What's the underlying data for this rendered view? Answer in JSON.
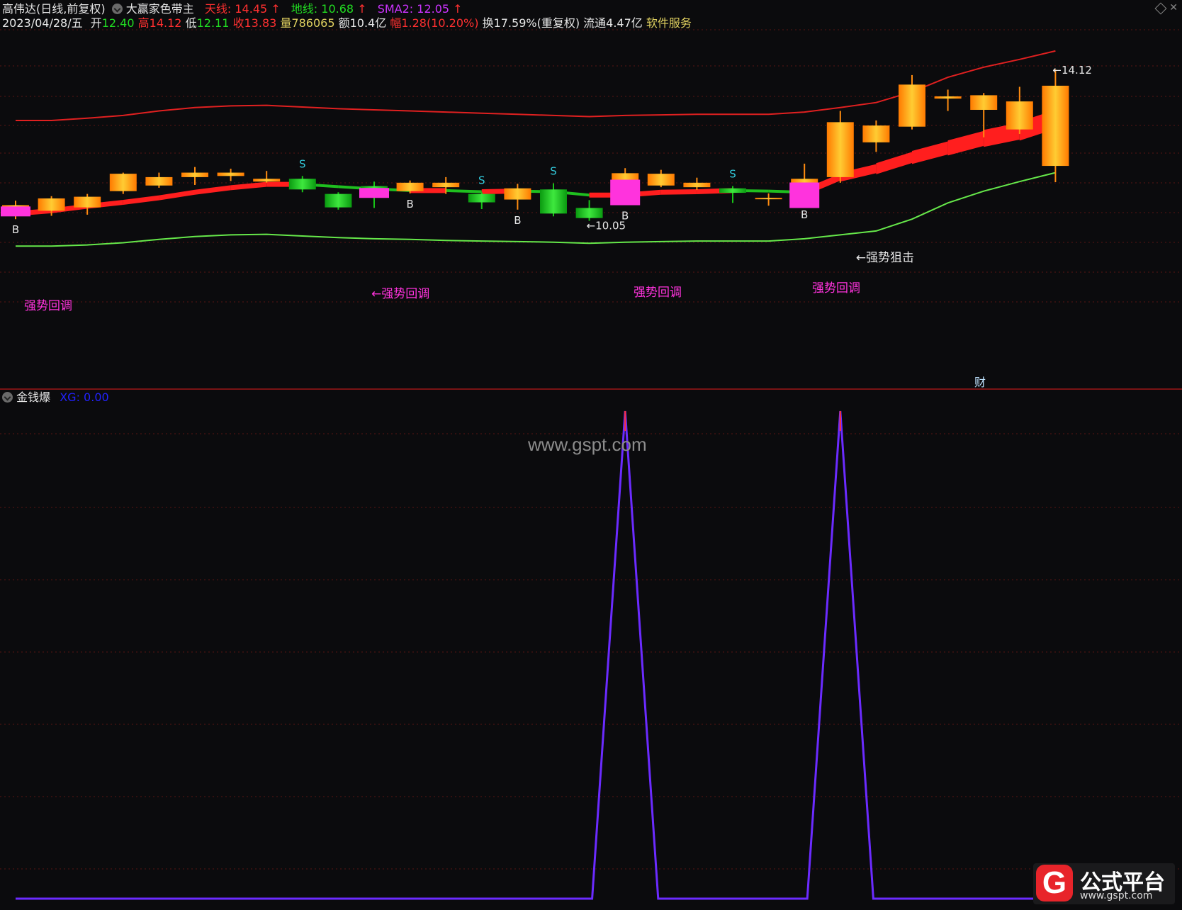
{
  "header": {
    "stock": "高伟达(日线,前复权)",
    "indicator_name": "大赢家色带主",
    "tianxian_label": "天线:",
    "tianxian_value": "14.45",
    "dixian_label": "地线:",
    "dixian_value": "10.68",
    "sma2_label": "SMA2:",
    "sma2_value": "12.05",
    "arrow": "↑",
    "date": "2023/04/28/五",
    "open_label": "开",
    "open_value": "12.40",
    "high_label": "高",
    "high_value": "14.12",
    "low_label": "低",
    "low_value": "12.11",
    "close_label": "收",
    "close_value": "13.83",
    "volume_label": "量",
    "volume_value": "786065",
    "amount": "额10.4亿",
    "range_label": "幅",
    "range_value": "1.28(10.20%)",
    "turnover": "换17.59%(重复权)",
    "float_cap": "流通4.47亿",
    "service": "软件服务"
  },
  "indicator": {
    "name": "金钱爆",
    "xg_label": "XG:",
    "xg_value": "0.00"
  },
  "colors": {
    "bg": "#0b0b0d",
    "up": "#ff9a1a",
    "down": "#14c21a",
    "upper_band": "#e02020",
    "lower_band": "#66e84a",
    "signal": "#ff33dd",
    "xg_line": "#6b2bff",
    "grid": "#5a1414",
    "text_white": "#e6e6e6",
    "text_red": "#ff3030",
    "text_green": "#22dd22",
    "text_magenta": "#cc33ff",
    "text_yellow": "#e0d060",
    "text_cyan": "#33ccdd",
    "text_blue": "#2222ff"
  },
  "chart_data": [
    {
      "type": "candlestick",
      "title": "大赢家色带主",
      "candles": [
        {
          "o": 11.55,
          "c": 11.7,
          "h": 11.78,
          "l": 11.45
        },
        {
          "o": 11.6,
          "c": 11.82,
          "h": 11.86,
          "l": 11.51
        },
        {
          "o": 11.66,
          "c": 11.85,
          "h": 11.9,
          "l": 11.53
        },
        {
          "o": 11.95,
          "c": 12.26,
          "h": 12.28,
          "l": 11.9
        },
        {
          "o": 12.05,
          "c": 12.2,
          "h": 12.28,
          "l": 12.01
        },
        {
          "o": 12.2,
          "c": 12.28,
          "h": 12.38,
          "l": 12.06
        },
        {
          "o": 12.22,
          "c": 12.28,
          "h": 12.35,
          "l": 12.13
        },
        {
          "o": 12.12,
          "c": 12.17,
          "h": 12.31,
          "l": 12.1
        },
        {
          "o": 12.17,
          "c": 11.98,
          "h": 12.22,
          "l": 11.93
        },
        {
          "o": 11.9,
          "c": 11.66,
          "h": 11.93,
          "l": 11.62
        },
        {
          "o": 12.04,
          "c": 11.88,
          "h": 12.12,
          "l": 11.65
        },
        {
          "o": 11.95,
          "c": 12.1,
          "h": 12.14,
          "l": 11.91
        },
        {
          "o": 12.02,
          "c": 12.1,
          "h": 12.2,
          "l": 11.9
        },
        {
          "o": 11.9,
          "c": 11.75,
          "h": 11.93,
          "l": 11.63
        },
        {
          "o": 11.8,
          "c": 12.0,
          "h": 12.08,
          "l": 11.62
        },
        {
          "o": 11.98,
          "c": 11.55,
          "h": 12.09,
          "l": 11.5
        },
        {
          "o": 11.65,
          "c": 11.47,
          "h": 11.79,
          "l": 11.42
        },
        {
          "o": 11.8,
          "c": 12.27,
          "h": 12.36,
          "l": 11.7
        },
        {
          "o": 12.05,
          "c": 12.26,
          "h": 12.33,
          "l": 12.02
        },
        {
          "o": 12.02,
          "c": 12.1,
          "h": 12.19,
          "l": 11.97
        },
        {
          "o": 12.0,
          "c": 11.92,
          "h": 12.04,
          "l": 11.74
        },
        {
          "o": 11.82,
          "c": 11.83,
          "h": 11.91,
          "l": 11.69
        },
        {
          "o": 11.75,
          "c": 12.17,
          "h": 12.44,
          "l": 11.72
        },
        {
          "o": 12.2,
          "c": 13.18,
          "h": 13.38,
          "l": 12.1
        },
        {
          "o": 12.82,
          "c": 13.12,
          "h": 13.21,
          "l": 12.65
        },
        {
          "o": 13.1,
          "c": 13.85,
          "h": 14.02,
          "l": 13.05
        },
        {
          "o": 13.6,
          "c": 13.64,
          "h": 13.76,
          "l": 13.38
        },
        {
          "o": 13.4,
          "c": 13.66,
          "h": 13.7,
          "l": 12.91
        },
        {
          "o": 13.05,
          "c": 13.55,
          "h": 13.81,
          "l": 12.97
        },
        {
          "o": 12.4,
          "c": 13.83,
          "h": 14.12,
          "l": 12.11
        }
      ],
      "series": [
        {
          "name": "天线",
          "values": [
            13.21,
            13.21,
            13.25,
            13.3,
            13.38,
            13.44,
            13.47,
            13.48,
            13.45,
            13.42,
            13.4,
            13.38,
            13.36,
            13.34,
            13.32,
            13.3,
            13.28,
            13.3,
            13.31,
            13.32,
            13.32,
            13.32,
            13.36,
            13.44,
            13.53,
            13.72,
            13.98,
            14.16,
            14.3,
            14.45
          ]
        },
        {
          "name": "地线",
          "values": [
            10.97,
            10.97,
            10.99,
            11.03,
            11.09,
            11.14,
            11.17,
            11.18,
            11.15,
            11.12,
            11.1,
            11.09,
            11.07,
            11.06,
            11.05,
            11.04,
            11.02,
            11.04,
            11.05,
            11.06,
            11.06,
            11.06,
            11.1,
            11.17,
            11.24,
            11.45,
            11.74,
            11.95,
            12.12,
            12.28
          ]
        },
        {
          "name": "SMA2",
          "values": [
            11.55,
            11.6,
            11.68,
            11.75,
            11.83,
            11.93,
            12.01,
            12.07,
            12.07,
            12.03,
            11.99,
            11.96,
            11.96,
            11.94,
            11.95,
            11.94,
            11.88,
            11.88,
            11.93,
            11.94,
            11.96,
            11.95,
            11.93,
            12.2,
            12.35,
            12.55,
            12.72,
            12.89,
            13.02,
            13.23
          ]
        }
      ],
      "annotations": [
        {
          "text": "S",
          "index": 8
        },
        {
          "text": "S",
          "index": 13
        },
        {
          "text": "S",
          "index": 15
        },
        {
          "text": "S",
          "index": 20
        },
        {
          "text": "B",
          "index": 0
        },
        {
          "text": "B",
          "index": 11
        },
        {
          "text": "B",
          "index": 14
        },
        {
          "text": "B",
          "index": 17
        },
        {
          "text": "B",
          "index": 22
        },
        {
          "text": "强势回调",
          "index": 0
        },
        {
          "text": "←强势回调",
          "index": 10
        },
        {
          "text": "←10.05",
          "index": 16
        },
        {
          "text": "强势回调",
          "index": 17
        },
        {
          "text": "←强势狙击",
          "index": 23
        },
        {
          "text": "强势回调",
          "index": 22
        },
        {
          "text": "←14.12",
          "index": 29
        },
        {
          "text": "财",
          "index": 27
        }
      ]
    },
    {
      "type": "line",
      "title": "金钱爆",
      "series": [
        {
          "name": "XG",
          "values": [
            0,
            0,
            0,
            0,
            0,
            0,
            0,
            0,
            0,
            0,
            0,
            0,
            0,
            0,
            0,
            0,
            0,
            1,
            0,
            0,
            0,
            0,
            0,
            1,
            0,
            0,
            0,
            0,
            0,
            0
          ]
        }
      ],
      "ylim": [
        0,
        1
      ]
    }
  ],
  "watermark": "www.gspt.com",
  "logo": {
    "mark": "G",
    "name": "公式平台",
    "url": "www.gspt.com"
  }
}
